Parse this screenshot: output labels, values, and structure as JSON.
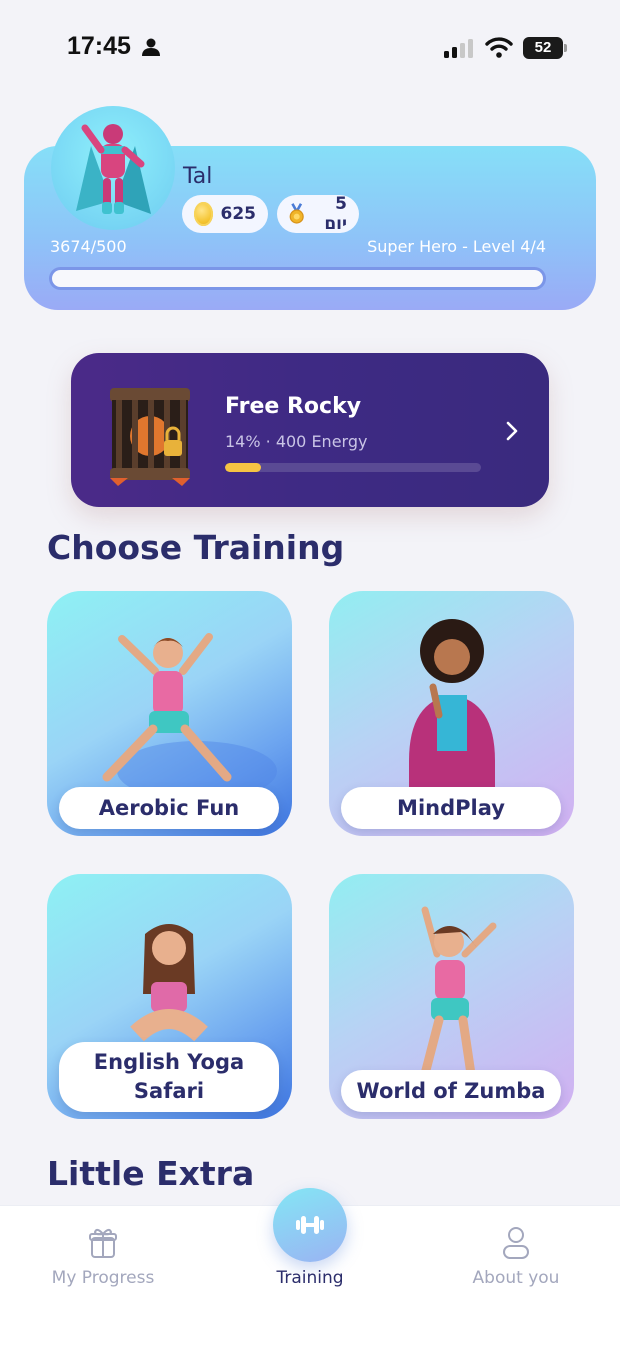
{
  "status_bar": {
    "time": "17:45",
    "battery": "52",
    "battery_level": 0.52
  },
  "profile": {
    "name": "Tal",
    "coins": "625",
    "streak": "5 יום",
    "progress_text": "3674/500",
    "level_text": "Super Hero - Level 4/4",
    "xp_fill": 1.0
  },
  "rocky": {
    "title": "Free Rocky",
    "subtitle": "14% · 400 Energy",
    "progress": 0.14
  },
  "sections": {
    "choose_training": "Choose Training",
    "little_extra": "Little Extra"
  },
  "trainings": [
    {
      "label": "Aerobic Fun"
    },
    {
      "label": "MindPlay"
    },
    {
      "label": "English Yoga Safari"
    },
    {
      "label": "World of Zumba"
    }
  ],
  "nav": {
    "progress": "My Progress",
    "training": "Training",
    "about": "About you"
  },
  "icons": {
    "person": "person-icon",
    "signal": "cellular-signal-icon",
    "wifi": "wifi-icon",
    "battery": "battery-icon",
    "coin": "coin-icon",
    "medal": "medal-icon",
    "cage": "locked-cage-icon",
    "chevron": "chevron-right-icon",
    "gift": "gift-icon",
    "dumbbell": "dumbbell-icon",
    "user": "user-icon"
  },
  "colors": {
    "accent": "#2b2d6b",
    "rocky_bg": "#3e2a84",
    "rocky_progress": "#f6c343",
    "nav_inactive": "#a3a7bd"
  }
}
